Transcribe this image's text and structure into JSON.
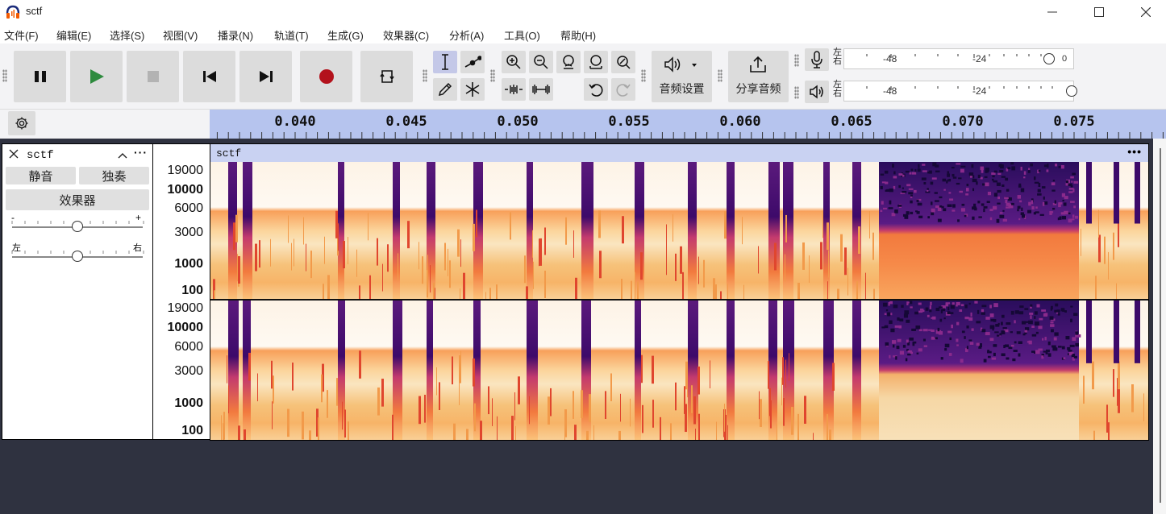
{
  "window": {
    "title": "sctf"
  },
  "menu": [
    {
      "label": "文件(F)"
    },
    {
      "label": "编辑(E)"
    },
    {
      "label": "选择(S)"
    },
    {
      "label": "视图(V)"
    },
    {
      "label": "播录(N)"
    },
    {
      "label": "轨道(T)"
    },
    {
      "label": "生成(G)"
    },
    {
      "label": "效果器(C)"
    },
    {
      "label": "分析(A)"
    },
    {
      "label": "工具(O)"
    },
    {
      "label": "帮助(H)"
    }
  ],
  "toolbar": {
    "transport": [
      "pause-icon",
      "play-icon",
      "stop-icon",
      "skip-start-icon",
      "skip-end-icon",
      "record-icon",
      "loop-icon"
    ],
    "audio_setup_label": "音频设置",
    "share_audio_label": "分享音频",
    "meters": {
      "record": {
        "left": "左",
        "right": "右",
        "ticks": [
          "-48",
          "-24"
        ],
        "end_value": "0"
      },
      "playback": {
        "left": "左",
        "right": "右",
        "ticks": [
          "-48",
          "-24"
        ]
      }
    }
  },
  "ruler": {
    "labels": [
      "0.040",
      "0.045",
      "0.050",
      "0.055",
      "0.060",
      "0.065",
      "0.070",
      "0.075"
    ]
  },
  "track": {
    "name": "sctf",
    "mute_label": "静音",
    "solo_label": "独奏",
    "effects_label": "效果器",
    "gain": {
      "minus": "-",
      "plus": "+",
      "value": 0.5
    },
    "pan": {
      "left": "左",
      "right": "右",
      "value": 0.5
    },
    "menu_label": "···"
  },
  "clip": {
    "name": "sctf",
    "menu_label": "•••"
  },
  "freq_scale": {
    "labels": [
      "19000",
      "10000",
      "6000",
      "3000",
      "1000",
      "100"
    ]
  },
  "colors": {
    "ruler_bg": "#b6c4ee",
    "clip_header": "#c9d2f2",
    "background": "#2f3240",
    "spectrogram_dark": "#4a0d6e",
    "spectrogram_hot": "#f88a44"
  }
}
